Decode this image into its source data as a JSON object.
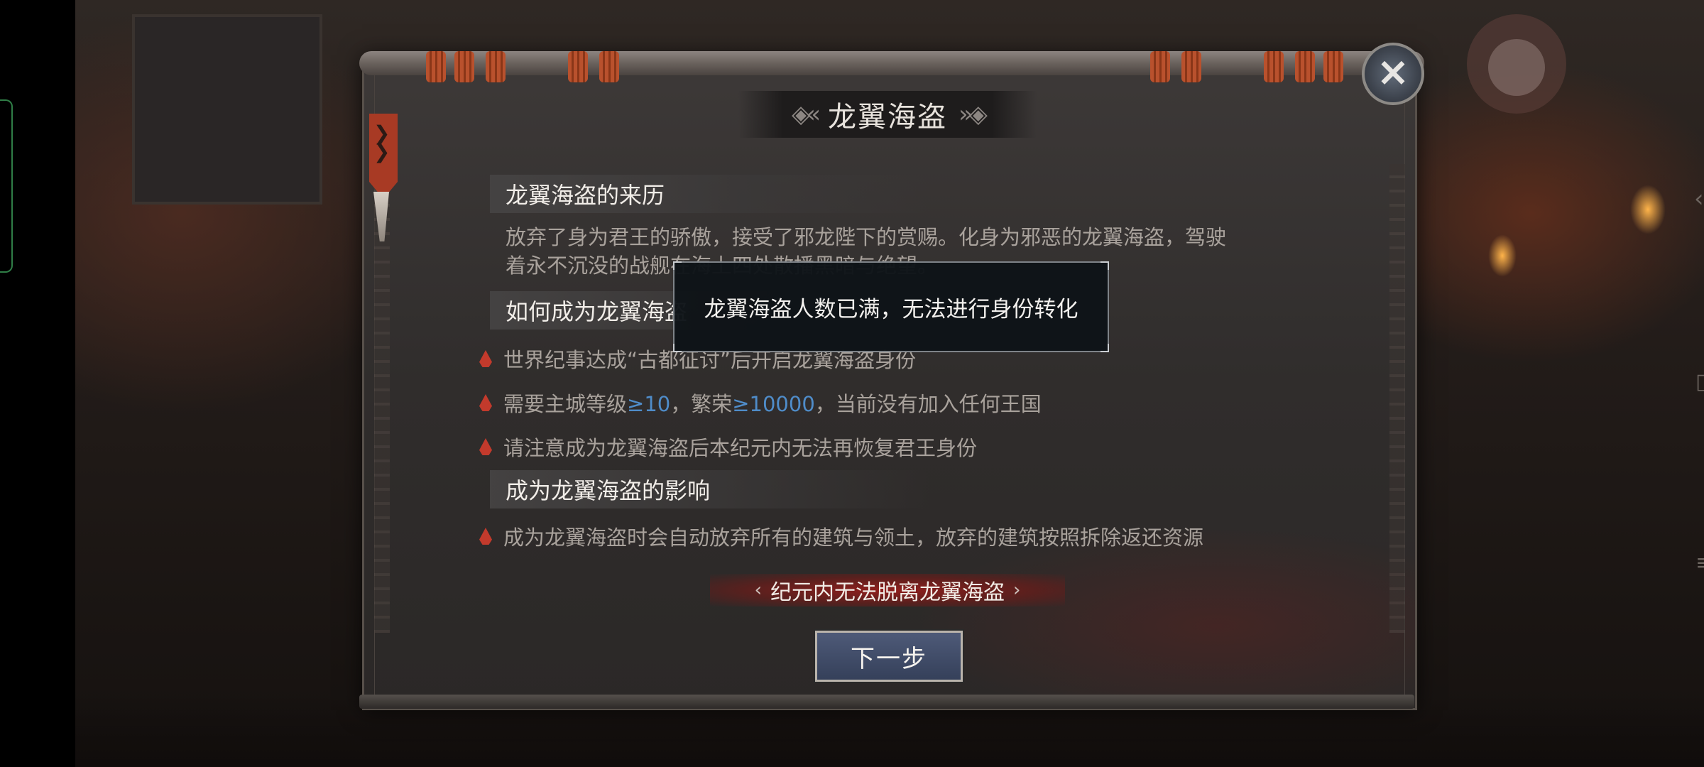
{
  "dialog": {
    "title": "龙翼海盗",
    "close_icon": "×",
    "sections": {
      "origin": {
        "heading": "龙翼海盗的来历",
        "body_line1": "放弃了身为君王的骄傲，接受了邪龙陛下的赏赐。化身为邪恶的龙翼海盗，驾驶",
        "body_line2": "着永不沉没的战舰在海上四处散播黑暗与绝望。"
      },
      "how_to": {
        "heading": "如何成为龙翼海盗",
        "bullet1": "世界纪事达成“古都征讨”后开启龙翼海盗身份",
        "bullet2_prefix": "需要主城等级",
        "bullet2_level": "≥10",
        "bullet2_mid": "，繁荣",
        "bullet2_prosperity": "≥10000",
        "bullet2_suffix": "，当前没有加入任何王国",
        "bullet3": "请注意成为龙翼海盗后本纪元内无法再恢复君王身份"
      },
      "effects": {
        "heading": "成为龙翼海盗的影响",
        "bullet1": "成为龙翼海盗时会自动放弃所有的建筑与领土，放弃的建筑按照拆除返还资源"
      }
    },
    "warning_banner": "纪元内无法脱离龙翼海盗",
    "next_button": "下一步"
  },
  "tooltip": {
    "message": "龙翼海盗人数已满，无法进行身份转化"
  },
  "colors": {
    "highlight": "#4f8cc9",
    "bullet_mark": "#c33a2c",
    "warning_banner": "#961e1c",
    "button": "#3f4a66"
  }
}
